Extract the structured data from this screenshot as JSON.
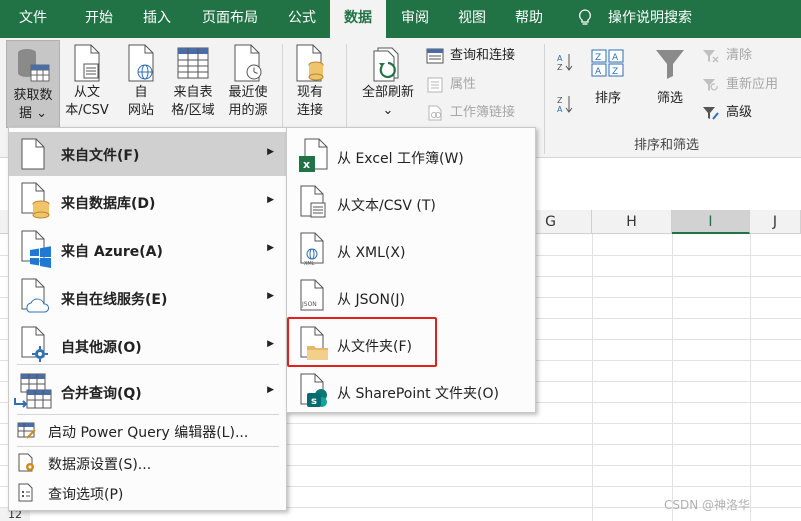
{
  "tabs": [
    {
      "label": "文件"
    },
    {
      "label": "开始"
    },
    {
      "label": "插入"
    },
    {
      "label": "页面布局"
    },
    {
      "label": "公式"
    },
    {
      "label": "数据"
    },
    {
      "label": "审阅"
    },
    {
      "label": "视图"
    },
    {
      "label": "帮助"
    }
  ],
  "search_label": "操作说明搜索",
  "ribbon": {
    "get_data": {
      "line1": "获取数",
      "line2": "据 ⌄"
    },
    "from_text": {
      "line1": "从文",
      "line2": "本/CSV"
    },
    "from_web": {
      "line1": "自",
      "line2": "网站"
    },
    "from_table": {
      "line1": "来自表",
      "line2": "格/区域"
    },
    "recent_sources": {
      "line1": "最近使",
      "line2": "用的源"
    },
    "existing_conn": {
      "line1": "现有",
      "line2": "连接"
    },
    "refresh_all": {
      "line1": "全部刷新",
      "line2": "⌄"
    },
    "queries_conn": "查询和连接",
    "properties": "属性",
    "edit_links": "工作簿链接",
    "sort": "排序",
    "filter": "筛选",
    "clear": "清除",
    "reapply": "重新应用",
    "advanced": "高级",
    "sort_filter_group": "排序和筛选"
  },
  "columns": [
    "G",
    "H",
    "I",
    "J"
  ],
  "main_menu": {
    "items": [
      {
        "label": "来自文件(F)",
        "submenu": true
      },
      {
        "label": "来自数据库(D)",
        "submenu": true
      },
      {
        "label": "来自 Azure(A)",
        "submenu": true
      },
      {
        "label": "来自在线服务(E)",
        "submenu": true
      },
      {
        "label": "自其他源(O)",
        "submenu": true
      },
      {
        "label": "合并查询(Q)",
        "submenu": true
      }
    ],
    "commands": [
      {
        "label": "启动 Power Query 编辑器(L)..."
      },
      {
        "label": "数据源设置(S)..."
      },
      {
        "label": "查询选项(P)"
      }
    ]
  },
  "sub_menu": {
    "items": [
      {
        "label": "从 Excel 工作簿(W)"
      },
      {
        "label": "从文本/CSV (T)"
      },
      {
        "label": "从 XML(X)"
      },
      {
        "label": "从 JSON(J)"
      },
      {
        "label": "从文件夹(F)"
      },
      {
        "label": "从 SharePoint 文件夹(O)"
      }
    ]
  },
  "row_number": "12",
  "watermark": "CSDN @神洛华",
  "colors": {
    "excel_green": "#217346",
    "highlight_red": "#e0221b"
  }
}
